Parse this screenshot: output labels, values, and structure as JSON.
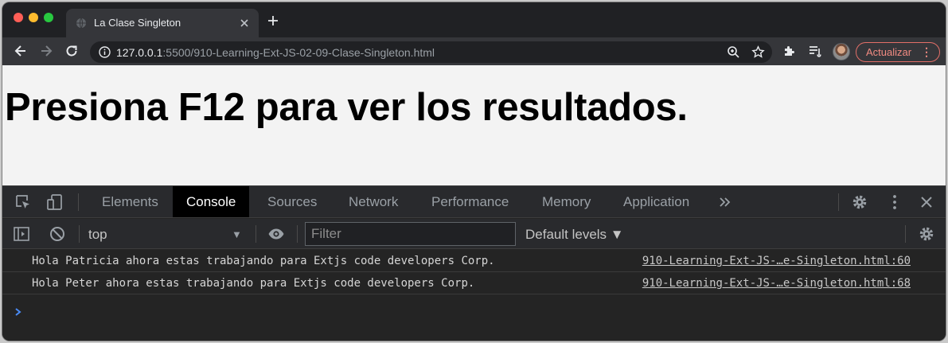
{
  "window": {
    "tab_title": "La Clase Singleton"
  },
  "toolbar": {
    "url_host": "127.0.0.1",
    "url_path": ":5500/910-Learning-Ext-JS-02-09-Clase-Singleton.html",
    "update_label": "Actualizar",
    "update_menu": "⋮"
  },
  "page": {
    "heading": "Presiona F12 para ver los resultados."
  },
  "devtools": {
    "tabs": [
      "Elements",
      "Console",
      "Sources",
      "Network",
      "Performance",
      "Memory",
      "Application"
    ],
    "active_tab": "Console",
    "context": "top",
    "filter_placeholder": "Filter",
    "levels_label": "Default levels ▼",
    "console_messages": [
      {
        "text": "Hola Patricia ahora estas trabajando para Extjs code developers Corp.",
        "source": "910-Learning-Ext-JS-…e-Singleton.html:60"
      },
      {
        "text": "Hola Peter ahora estas trabajando para Extjs code developers Corp.",
        "source": "910-Learning-Ext-JS-…e-Singleton.html:68"
      }
    ]
  },
  "colors": {
    "accent_update": "#f28b82",
    "devtools_bg": "#242424",
    "prompt_blue": "#4a8cf7"
  }
}
